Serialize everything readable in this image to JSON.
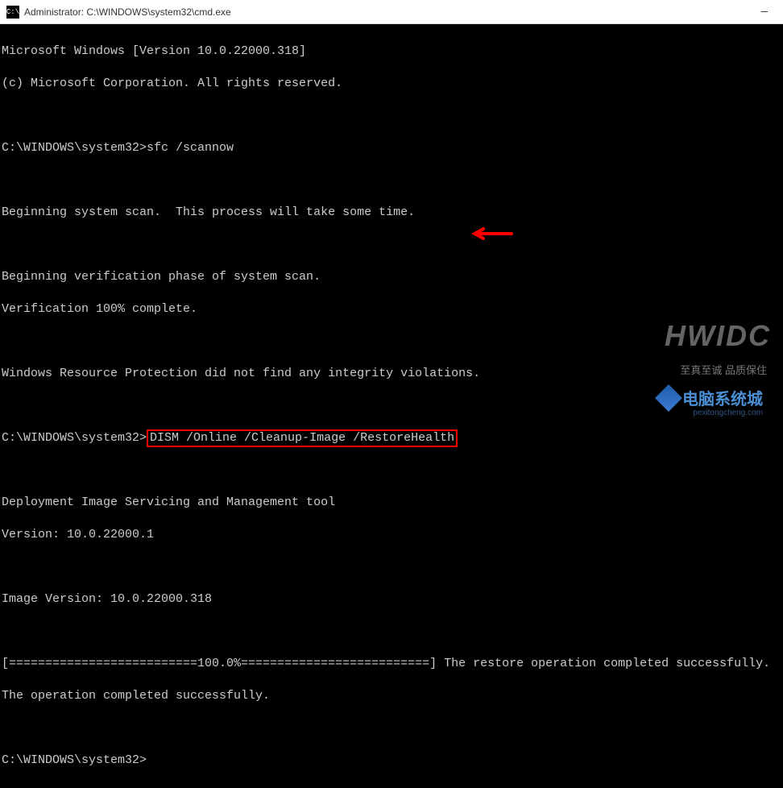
{
  "titlebar": {
    "icon_text": "C:\\",
    "title": "Administrator: C:\\WINDOWS\\system32\\cmd.exe"
  },
  "window_controls": {
    "minimize": "—"
  },
  "terminal": {
    "line1": "Microsoft Windows [Version 10.0.22000.318]",
    "line2": "(c) Microsoft Corporation. All rights reserved.",
    "line3": "",
    "prompt1_path": "C:\\WINDOWS\\system32>",
    "prompt1_cmd": "sfc /scannow",
    "line5": "",
    "line6": "Beginning system scan.  This process will take some time.",
    "line7": "",
    "line8": "Beginning verification phase of system scan.",
    "line9": "Verification 100% complete.",
    "line10": "",
    "line11": "Windows Resource Protection did not find any integrity violations.",
    "line12": "",
    "prompt2_path": "C:\\WINDOWS\\system32>",
    "prompt2_cmd": "DISM /Online /Cleanup-Image /RestoreHealth",
    "line14": "",
    "line15": "Deployment Image Servicing and Management tool",
    "line16": "Version: 10.0.22000.1",
    "line17": "",
    "line18": "Image Version: 10.0.22000.318",
    "line19": "",
    "line20": "[==========================100.0%==========================] The restore operation completed successfully.",
    "line21": "The operation completed successfully.",
    "line22": "",
    "prompt3_path": "C:\\WINDOWS\\system32>"
  },
  "watermarks": {
    "hwidc": "HWIDC",
    "chinese_tagline": "至真至诚 品质保住",
    "logo_text": "电脑系统城",
    "logo_sub": "pexitongcheng.com"
  }
}
